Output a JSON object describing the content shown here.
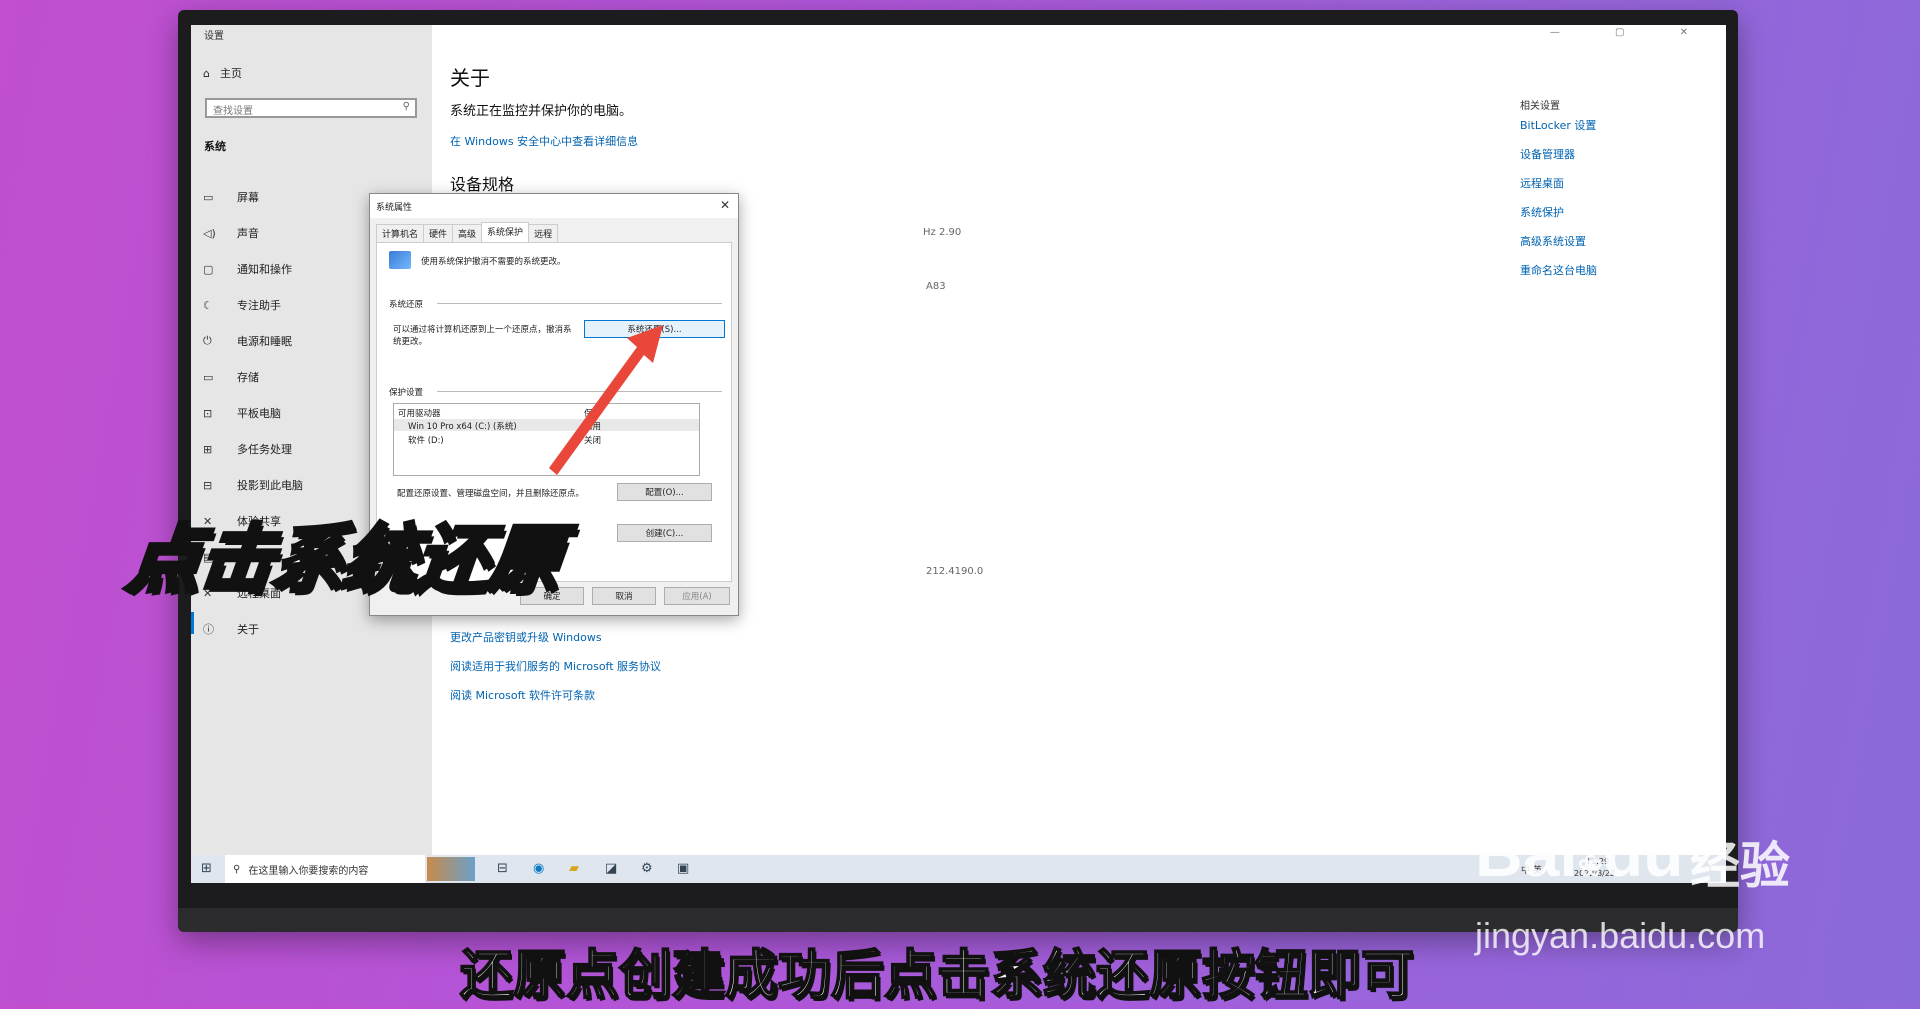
{
  "window": {
    "title": "设置",
    "controls": "— ▢ ✕"
  },
  "sidebar": {
    "home": "主页",
    "search_placeholder": "查找设置",
    "section": "系统",
    "items": [
      {
        "icon": "display-icon",
        "glyph": "▭",
        "label": "屏幕"
      },
      {
        "icon": "speaker-icon",
        "glyph": "◁)",
        "label": "声音"
      },
      {
        "icon": "notification-icon",
        "glyph": "▢",
        "label": "通知和操作"
      },
      {
        "icon": "focus-assist-icon",
        "glyph": "☾",
        "label": "专注助手"
      },
      {
        "icon": "power-icon",
        "glyph": "⏻",
        "label": "电源和睡眠"
      },
      {
        "icon": "storage-icon",
        "glyph": "▭",
        "label": "存储"
      },
      {
        "icon": "tablet-icon",
        "glyph": "⊡",
        "label": "平板电脑"
      },
      {
        "icon": "multitask-icon",
        "glyph": "⊞",
        "label": "多任务处理"
      },
      {
        "icon": "project-icon",
        "glyph": "⊟",
        "label": "投影到此电脑"
      },
      {
        "icon": "shared-experience-icon",
        "glyph": "✕",
        "label": "体验共享"
      },
      {
        "icon": "clipboard-icon",
        "glyph": "▤",
        "label": "剪贴板"
      },
      {
        "icon": "remote-desktop-icon",
        "glyph": "✕",
        "label": "远程桌面"
      },
      {
        "icon": "info-icon",
        "glyph": "ⓘ",
        "label": "关于"
      }
    ]
  },
  "main": {
    "title": "关于",
    "status": "系统正在监控并保护你的电脑。",
    "security_link": "在 Windows 安全中心中查看详细信息",
    "spec_title": "设备规格",
    "ghost_cpu": "Hz   2.90",
    "ghost_id": "A83",
    "ghost_build": "212.4190.0",
    "links": [
      "更改产品密钥或升级 Windows",
      "阅读适用于我们服务的 Microsoft 服务协议",
      "阅读 Microsoft 软件许可条款"
    ],
    "related_title": "相关设置",
    "related_links": [
      "BitLocker 设置",
      "设备管理器",
      "远程桌面",
      "系统保护",
      "高级系统设置",
      "重命名这台电脑"
    ]
  },
  "dialog": {
    "title": "系统属性",
    "tabs": [
      "计算机名",
      "硬件",
      "高级",
      "系统保护",
      "远程"
    ],
    "intro": "使用系统保护撤消不需要的系统更改。",
    "restore_section": "系统还原",
    "restore_desc_1": "可以通过将计算机还原到上一个还原点，撤消系",
    "restore_desc_2": "统更改。",
    "restore_button": "系统还原(S)...",
    "protection_section": "保护设置",
    "drive_header": "可用驱动器",
    "protect_header": "保护",
    "drives": [
      {
        "name": "Win 10 Pro x64 (C:) (系统)",
        "status": "启用"
      },
      {
        "name": "软件 (D:)",
        "status": "关闭"
      }
    ],
    "config_text": "配置还原设置、管理磁盘空间，并且删除还原点。",
    "config_button": "配置(O)...",
    "create_button": "创建(C)...",
    "ok": "确定",
    "cancel": "取消",
    "apply": "应用(A)"
  },
  "taskbar": {
    "search_placeholder": "在这里输入你要搜索的内容",
    "tray_lang": "中 英",
    "clock": "11:29",
    "date": "2022/8/22"
  },
  "overlay": {
    "caption": "点击系统还原",
    "subtitle": "还原点创建成功后点击系统还原按钮即可"
  },
  "watermark": {
    "logo": "Bai",
    "logo_du": "du",
    "jingyan": "经验",
    "url": "jingyan.baidu.com"
  },
  "colors": {
    "accent": "#0078d4",
    "link": "#0063b1",
    "arrow": "#e8473a"
  }
}
